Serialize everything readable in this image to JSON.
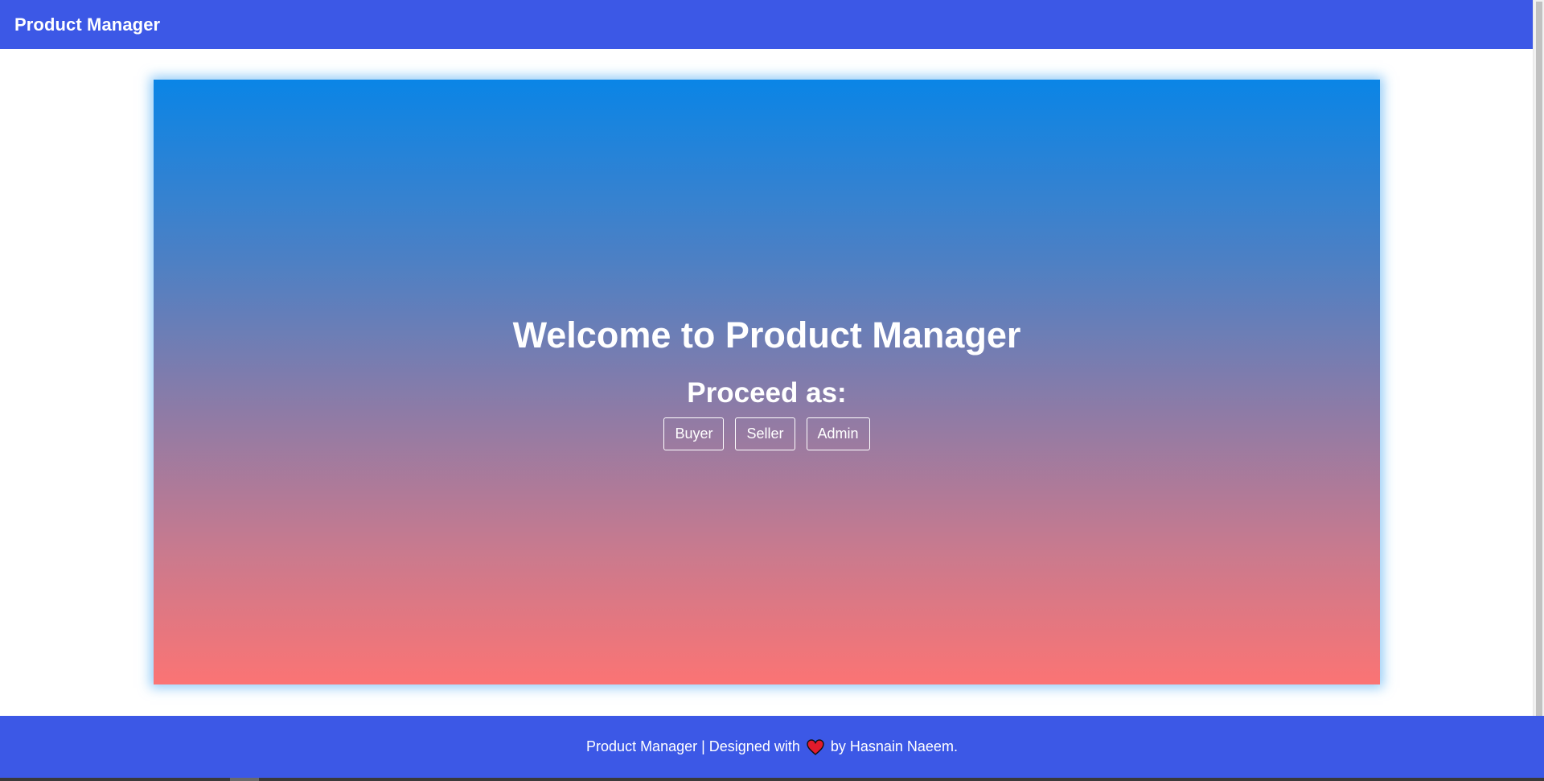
{
  "navbar": {
    "brand": "Product Manager"
  },
  "hero": {
    "title": "Welcome to Product Manager",
    "proceed_label": "Proceed as:",
    "buttons": [
      {
        "label": "Buyer"
      },
      {
        "label": "Seller"
      },
      {
        "label": "Admin"
      }
    ]
  },
  "footer": {
    "text_before": "Product Manager | Designed with",
    "icon": "heart-icon",
    "text_after": "by Hasnain Naeem."
  },
  "colors": {
    "nav_bg": "#3c58e6",
    "gradient_top": "#0a85e6",
    "gradient_bottom": "#fb7474",
    "heart": "#e21b2c"
  }
}
